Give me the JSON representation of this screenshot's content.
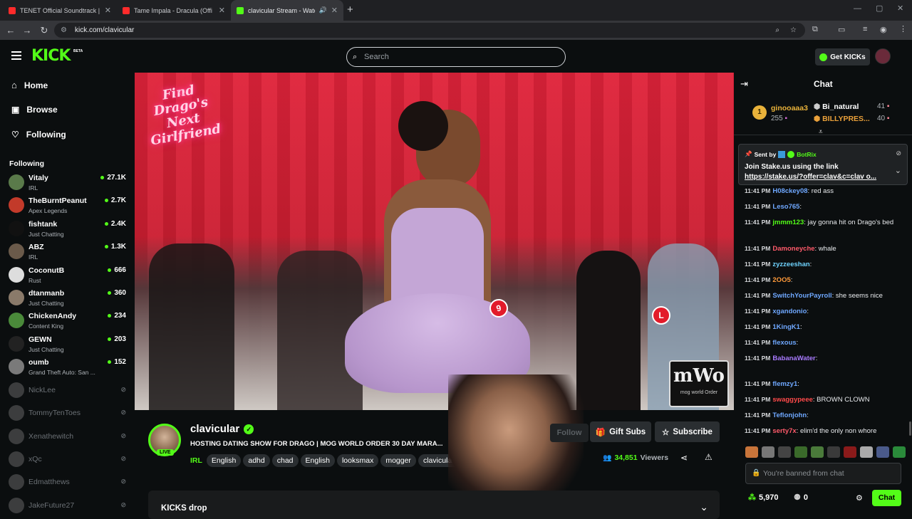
{
  "browser": {
    "tabs": [
      {
        "title": "TENET Official Soundtrack | FU..."
      },
      {
        "title": "Tame Impala - Dracula (Official..."
      },
      {
        "title": "clavicular Stream - Watch L..."
      }
    ],
    "url": "kick.com/clavicular"
  },
  "header": {
    "logo": "KICK",
    "beta": "BETA",
    "search_placeholder": "Search",
    "get_kicks": "Get KICKs"
  },
  "sidebar": {
    "nav": [
      {
        "label": "Home",
        "icon": "home-icon"
      },
      {
        "label": "Browse",
        "icon": "browse-icon"
      },
      {
        "label": "Following",
        "icon": "heart-icon"
      }
    ],
    "following_title": "Following",
    "live": [
      {
        "name": "Vitaly",
        "category": "IRL",
        "viewers": "27.1K",
        "color": "#5a7a4a"
      },
      {
        "name": "TheBurntPeanut",
        "category": "Apex Legends",
        "viewers": "2.7K",
        "color": "#c23a2a"
      },
      {
        "name": "fishtank",
        "category": "Just Chatting",
        "viewers": "2.4K",
        "color": "#111111"
      },
      {
        "name": "ABZ",
        "category": "IRL",
        "viewers": "1.3K",
        "color": "#6a5a4a"
      },
      {
        "name": "CoconutB",
        "category": "Rust",
        "viewers": "666",
        "color": "#dddddd"
      },
      {
        "name": "dtanmanb",
        "category": "Just Chatting",
        "viewers": "360",
        "color": "#8a7a6a"
      },
      {
        "name": "ChickenAndy",
        "category": "Content King",
        "viewers": "234",
        "color": "#4a8a3a"
      },
      {
        "name": "GEWN",
        "category": "Just Chatting",
        "viewers": "203",
        "color": "#222222"
      },
      {
        "name": "oumb",
        "category": "Grand Theft Auto: San ...",
        "viewers": "152",
        "color": "#7a7a7a"
      }
    ],
    "offline": [
      {
        "name": "NickLee"
      },
      {
        "name": "TommyTenToes"
      },
      {
        "name": "Xenathewitch"
      },
      {
        "name": "xQc"
      },
      {
        "name": "Edmatthews"
      },
      {
        "name": "JakeFuture27"
      }
    ]
  },
  "video": {
    "overlay_title_1": "Find",
    "overlay_title_2": "Drago's",
    "overlay_title_3": "Next",
    "overlay_title_4": "Girlfriend",
    "watermark": "mWo",
    "watermark_sub": "mog world Order",
    "number_tag": "9",
    "number_tag_2": "L"
  },
  "channel": {
    "name": "clavicular",
    "live_badge": "LIVE",
    "title": "HOSTING DATING SHOW FOR DRAGO | MOG WORLD ORDER 30 DAY MARA...",
    "category": "IRL",
    "tags": [
      "English",
      "adhd",
      "chad",
      "English",
      "looksmax",
      "mogger",
      "clavicula..."
    ],
    "follow": "Follow",
    "gift_subs": "Gift Subs",
    "subscribe": "Subscribe",
    "viewers": "34,851",
    "viewers_label": "Viewers",
    "kicks_drop": "KICKS drop"
  },
  "chat": {
    "title": "Chat",
    "leaderboard": [
      {
        "name": "ginooaaa3",
        "score": "255"
      },
      {
        "name": "Bi_natural",
        "score": "41"
      },
      {
        "name": "BILLYPRES...",
        "score": "40"
      }
    ],
    "pinned": {
      "sent_by_label": "Sent by",
      "sender": "BotRix",
      "text": "Join Stake.us using the link",
      "link": "https://stake.us/?offer=clav&c=clav o..."
    },
    "messages": [
      {
        "time": "11:41 PM",
        "user": "H08ckey08",
        "text": ": red ass",
        "color": "#6fa8ff"
      },
      {
        "time": "11:41 PM",
        "user": "Leso765",
        "text": ":",
        "color": "#6fa8ff"
      },
      {
        "time": "11:41 PM",
        "user": "jmmm123",
        "text": ": jay gonna hit on Drago's bed",
        "color": "#53fc18"
      },
      {
        "time": "11:41 PM",
        "user": "Damoneyche",
        "text": ": whale",
        "color": "#ff5a6a"
      },
      {
        "time": "11:41 PM",
        "user": "zyzzeeshan",
        "text": ":",
        "color": "#6fd3ff"
      },
      {
        "time": "11:41 PM",
        "user": "2OO5",
        "text": ":",
        "color": "#ff9a3a"
      },
      {
        "time": "11:41 PM",
        "user": "SwitchYourPayroll",
        "text": ": she seems nice",
        "color": "#6fa8ff"
      },
      {
        "time": "11:41 PM",
        "user": "xgandonio",
        "text": ":",
        "color": "#6fa8ff"
      },
      {
        "time": "11:41 PM",
        "user": "1KingK1",
        "text": ":",
        "color": "#6fa8ff"
      },
      {
        "time": "11:41 PM",
        "user": "flexous",
        "text": ":",
        "color": "#6fa8ff"
      },
      {
        "time": "11:41 PM",
        "user": "BabanaWater",
        "text": ":",
        "color": "#a97bff"
      },
      {
        "time": "11:41 PM",
        "user": "flemzy1",
        "text": ":",
        "color": "#6fa8ff"
      },
      {
        "time": "11:41 PM",
        "user": "swaggypeee",
        "text": ": BROWN CLOWN",
        "color": "#ff4a4a"
      },
      {
        "time": "11:41 PM",
        "user": "Teflonjohn",
        "text": ":",
        "color": "#6fa8ff"
      },
      {
        "time": "11:41 PM",
        "user": "serty7x",
        "text": ": elim'd the only non whore",
        "color": "#ff5a6a"
      }
    ],
    "banned_text": "You're banned from chat",
    "points": "5,970",
    "kicks": "0",
    "chat_button": "Chat"
  }
}
